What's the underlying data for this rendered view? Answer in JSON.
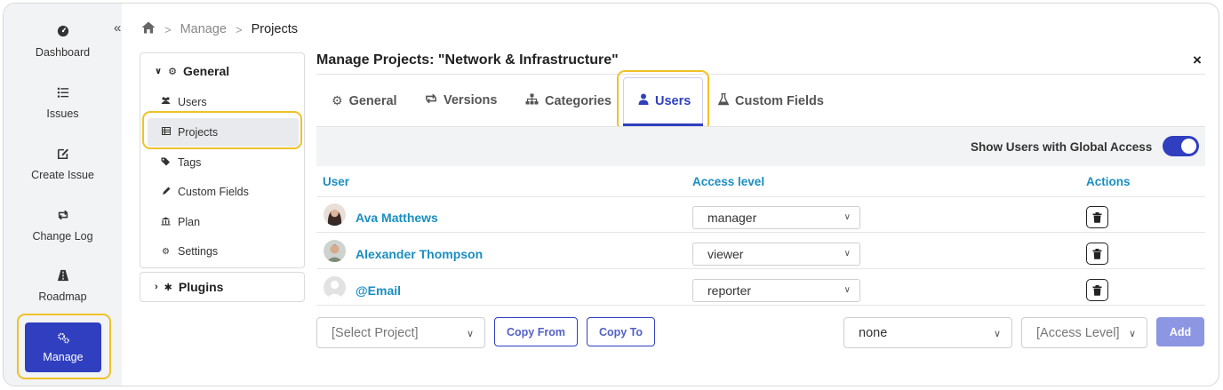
{
  "rail": {
    "items": [
      {
        "label": "Dashboard",
        "icon": "dashboard-icon"
      },
      {
        "label": "Issues",
        "icon": "list-icon"
      },
      {
        "label": "Create Issue",
        "icon": "edit-icon"
      },
      {
        "label": "Change Log",
        "icon": "sync-icon"
      },
      {
        "label": "Roadmap",
        "icon": "road-icon"
      }
    ],
    "manage_label": "Manage"
  },
  "breadcrumb": {
    "sep": ">",
    "items": [
      "Manage",
      "Projects"
    ]
  },
  "sidebar": {
    "general_label": "General",
    "items": [
      "Users",
      "Projects",
      "Tags",
      "Custom Fields",
      "Plan",
      "Settings"
    ],
    "plugins_label": "Plugins"
  },
  "main": {
    "title": "Manage Projects: \"Network & Infrastructure\"",
    "close_symbol": "×",
    "tabs": [
      "General",
      "Versions",
      "Categories",
      "Users",
      "Custom Fields"
    ],
    "global_access_label": "Show Users with Global Access",
    "global_access_on": true,
    "table": {
      "headers": [
        "User",
        "Access level",
        "Actions"
      ],
      "rows": [
        {
          "user": "Ava Matthews",
          "access": "manager"
        },
        {
          "user": "Alexander Thompson",
          "access": "viewer"
        },
        {
          "user": "@Email",
          "access": "reporter"
        }
      ]
    },
    "footer": {
      "project_select": "[Select Project]",
      "copy_from": "Copy From",
      "copy_to": "Copy To",
      "user_select": "none",
      "access_select": "[Access Level]",
      "add": "Add"
    }
  },
  "colors": {
    "accent": "#2f3fbf",
    "link": "#1a8ec0",
    "highlight": "#f0c127"
  }
}
